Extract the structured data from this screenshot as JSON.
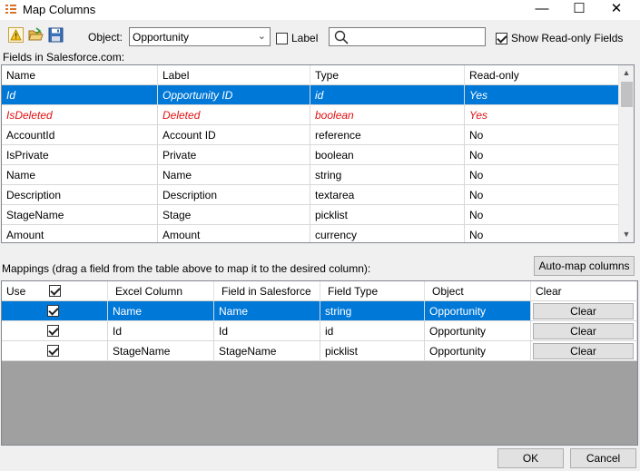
{
  "window": {
    "title": "Map Columns",
    "min_glyph": "—",
    "max_glyph": "☐",
    "close_glyph": "✕"
  },
  "toolbar": {
    "icons": [
      "warning-icon",
      "folder-open-icon",
      "save-icon"
    ],
    "object_label": "Object:",
    "object_value": "Opportunity",
    "label_checkbox_text": "Label",
    "label_checked": false,
    "search_value": "",
    "readonly_checkbox_text": "Show Read-only Fields",
    "readonly_checked": true
  },
  "fields_section": {
    "label": "Fields in Salesforce.com:",
    "columns": [
      "Name",
      "Label",
      "Type",
      "Read-only"
    ],
    "rows": [
      [
        "Id",
        "Opportunity ID",
        "id",
        "Yes"
      ],
      [
        "IsDeleted",
        "Deleted",
        "boolean",
        "Yes"
      ],
      [
        "AccountId",
        "Account ID",
        "reference",
        "No"
      ],
      [
        "IsPrivate",
        "Private",
        "boolean",
        "No"
      ],
      [
        "Name",
        "Name",
        "string",
        "No"
      ],
      [
        "Description",
        "Description",
        "textarea",
        "No"
      ],
      [
        "StageName",
        "Stage",
        "picklist",
        "No"
      ],
      [
        "Amount",
        "Amount",
        "currency",
        "No"
      ]
    ]
  },
  "mappings_section": {
    "label": "Mappings (drag a field from the table above to map it to the desired column):",
    "automap_label": "Auto-map columns",
    "columns": [
      "Use",
      "Excel Column",
      "Field in Salesforce",
      "Field Type",
      "Object",
      "Clear"
    ],
    "rows": [
      {
        "use": true,
        "excel": "Name",
        "field": "Name",
        "type": "string",
        "object": "Opportunity",
        "clear": "Clear"
      },
      {
        "use": true,
        "excel": "Id",
        "field": "Id",
        "type": "id",
        "object": "Opportunity",
        "clear": "Clear"
      },
      {
        "use": true,
        "excel": "StageName",
        "field": "StageName",
        "type": "picklist",
        "object": "Opportunity",
        "clear": "Clear"
      }
    ]
  },
  "buttons": {
    "ok": "OK",
    "cancel": "Cancel"
  },
  "colors": {
    "selection": "#0078d7",
    "deleted_text": "#e01010"
  }
}
